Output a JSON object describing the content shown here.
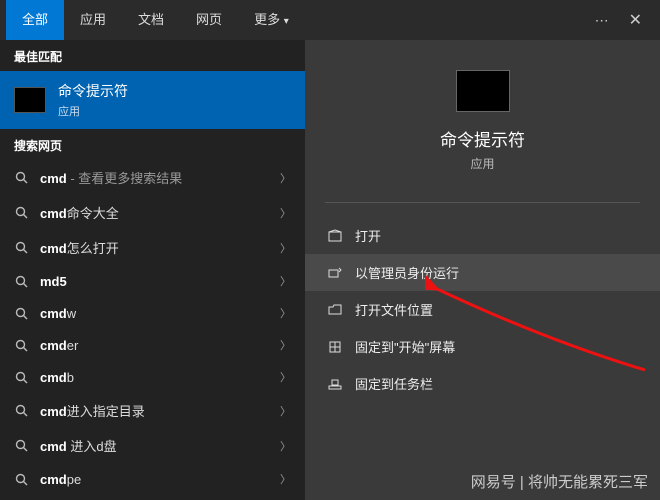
{
  "tabs": {
    "all": "全部",
    "apps": "应用",
    "docs": "文档",
    "web": "网页",
    "more": "更多"
  },
  "sections": {
    "best_match": "最佳匹配",
    "web_search": "搜索网页"
  },
  "best_match": {
    "title": "命令提示符",
    "subtitle": "应用"
  },
  "suggestions": [
    {
      "prefix": "cmd",
      "suffix": "",
      "extra": " - 查看更多搜索结果"
    },
    {
      "prefix": "cmd",
      "suffix": "命令大全",
      "extra": ""
    },
    {
      "prefix": "cmd",
      "suffix": "怎么打开",
      "extra": ""
    },
    {
      "prefix": "md5",
      "suffix": "",
      "extra": ""
    },
    {
      "prefix": "cmd",
      "suffix": "w",
      "extra": ""
    },
    {
      "prefix": "cmd",
      "suffix": "er",
      "extra": ""
    },
    {
      "prefix": "cmd",
      "suffix": "b",
      "extra": ""
    },
    {
      "prefix": "cmd",
      "suffix": "进入指定目录",
      "extra": ""
    },
    {
      "prefix": "cmd ",
      "suffix": "进入d盘",
      "extra": ""
    },
    {
      "prefix": "cmd",
      "suffix": "pe",
      "extra": ""
    }
  ],
  "detail": {
    "title": "命令提示符",
    "subtitle": "应用"
  },
  "actions": {
    "open": "打开",
    "run_admin": "以管理员身份运行",
    "open_location": "打开文件位置",
    "pin_start": "固定到\"开始\"屏幕",
    "pin_taskbar": "固定到任务栏"
  },
  "watermark": {
    "brand": "网易号",
    "sep": " | ",
    "author": "将帅无能累死三军"
  }
}
